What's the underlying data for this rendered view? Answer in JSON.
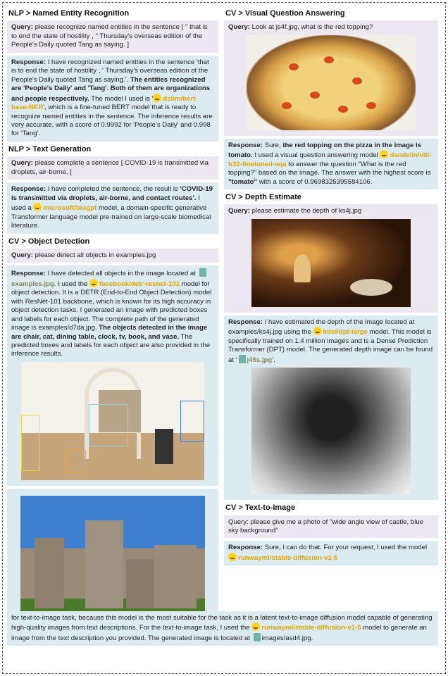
{
  "ner": {
    "title": "NLP > Named Entity Recognition",
    "query_label": "Query:",
    "query_text": "please recognize named entities in the sentence [ \" that is to end the state of hostility , \" Thursday's overseas edition of the People's Daily quoted Tang as saying. ]",
    "response_label": "Response:",
    "resp_a": "I have recognized named entities in the sentence 'that is to end the state of hostility , ' Thursday's overseas edition of the People's Daily quoted Tang as saying.'.",
    "resp_b": "The entities recognized are 'People's Daily' and 'Tang'. Both of them are organizations and people respectively.",
    "resp_c": "The model I used is '",
    "model": "dslim/bert-base-NER",
    "resp_d": "', which is a fine-tuned BERT model that is ready to recognize named entities in the sentence. The inference results are very accurate, with a score of 0.9992 for 'People's Daily' and 0.998 for 'Tang'."
  },
  "tg": {
    "title": "NLP > Text Generation",
    "query_label": "Query:",
    "query_text": "please complete a sentence [ COVID-19 is transmitted via droplets, air-borne, ]",
    "response_label": "Response:",
    "resp_a": "I have completed the sentence, the result is",
    "resp_b": "'COVID-19 is transmitted via droplets, air-borne, and contact routes'.",
    "resp_c": "I used a",
    "model": "microsoft/biogpt",
    "resp_d": "model, a domain-specific generative Transformer language model pre-trained on large-scale biomedical literature."
  },
  "od": {
    "title": "CV > Object Detection",
    "query_label": "Query:",
    "query_text": "please detect all objects in examples.jpg",
    "response_label": "Response:",
    "resp_a": "I have detected all objects in the image located at",
    "file": "examples.jpg.",
    "resp_b": "I used the",
    "model": "facebook/detr-resnet-101",
    "resp_c": "model for object detection. It is a DETR (End-to-End Object Detection) model with ResNet-101 backbone, which is known for its high accuracy in object detection tasks. I generated an image with predicted boxes and labels for each object. The complete path of the generated image is examples/d7da.jpg.",
    "resp_d": "The objects detected in the image are chair, cat, dining table, clock, tv, book, and vase.",
    "resp_e": "The predicted boxes and labels for each object are also provided in the inference results."
  },
  "vqa": {
    "title": "CV > Visual Question Answering",
    "query_label": "Query:",
    "query_text": "Look at js4f.jpg, what is the red topping?",
    "response_label": "Response:",
    "resp_a": "Sure,",
    "resp_b": "the red topping on the pizza in the image is tomato.",
    "resp_c": "I used a visual question answering model",
    "model": "dandelin/vilt-b32-finetuned-vqa",
    "resp_d": "to answer the question \"What is the red topping?\" based on the image. The answer with the highest score is",
    "answer": "\"tomato\"",
    "resp_e": "with a score of 0.9698325395584106."
  },
  "de": {
    "title": "CV > Depth Estimate",
    "query_label": "Query:",
    "query_text": "please estimate the depth of ks4j.jpg",
    "response_label": "Response:",
    "resp_a": "I have estimated the depth of the image located at examples/ks4j.jpg using the",
    "model": "Intel/dpt-large",
    "resp_b": "model. This model is specifically trained on 1.4 million images and is a Dense Prediction Transformer (DPT) model. The generated depth image can be found at '",
    "file": "j45s.jpg",
    "resp_c": "'."
  },
  "t2i": {
    "title": "CV  >  Text-to-Image",
    "query_label": "Query:",
    "query_text": "please give me a photo of \"wide angle view of castle, blue sky background\"",
    "response_label": "Response:",
    "resp_a": "Sure, I can do that. For your request, I used the model",
    "model": "runwayml/stable-diffusion-v1-5",
    "resp_b": "for text-to-image task, because this model is the most suitable for the task as it is a latent text-to-image diffusion model capable of generating high-quality images from text descriptions. For the text-to-image task, I used the",
    "resp_c": "model to generate an image from the text description you provided. The generated image is located at",
    "file": "images/asd4.jpg."
  },
  "colors": {
    "query_bg": "#ece7f0",
    "response_bg": "#dcebf0",
    "model": "#e3a400"
  }
}
